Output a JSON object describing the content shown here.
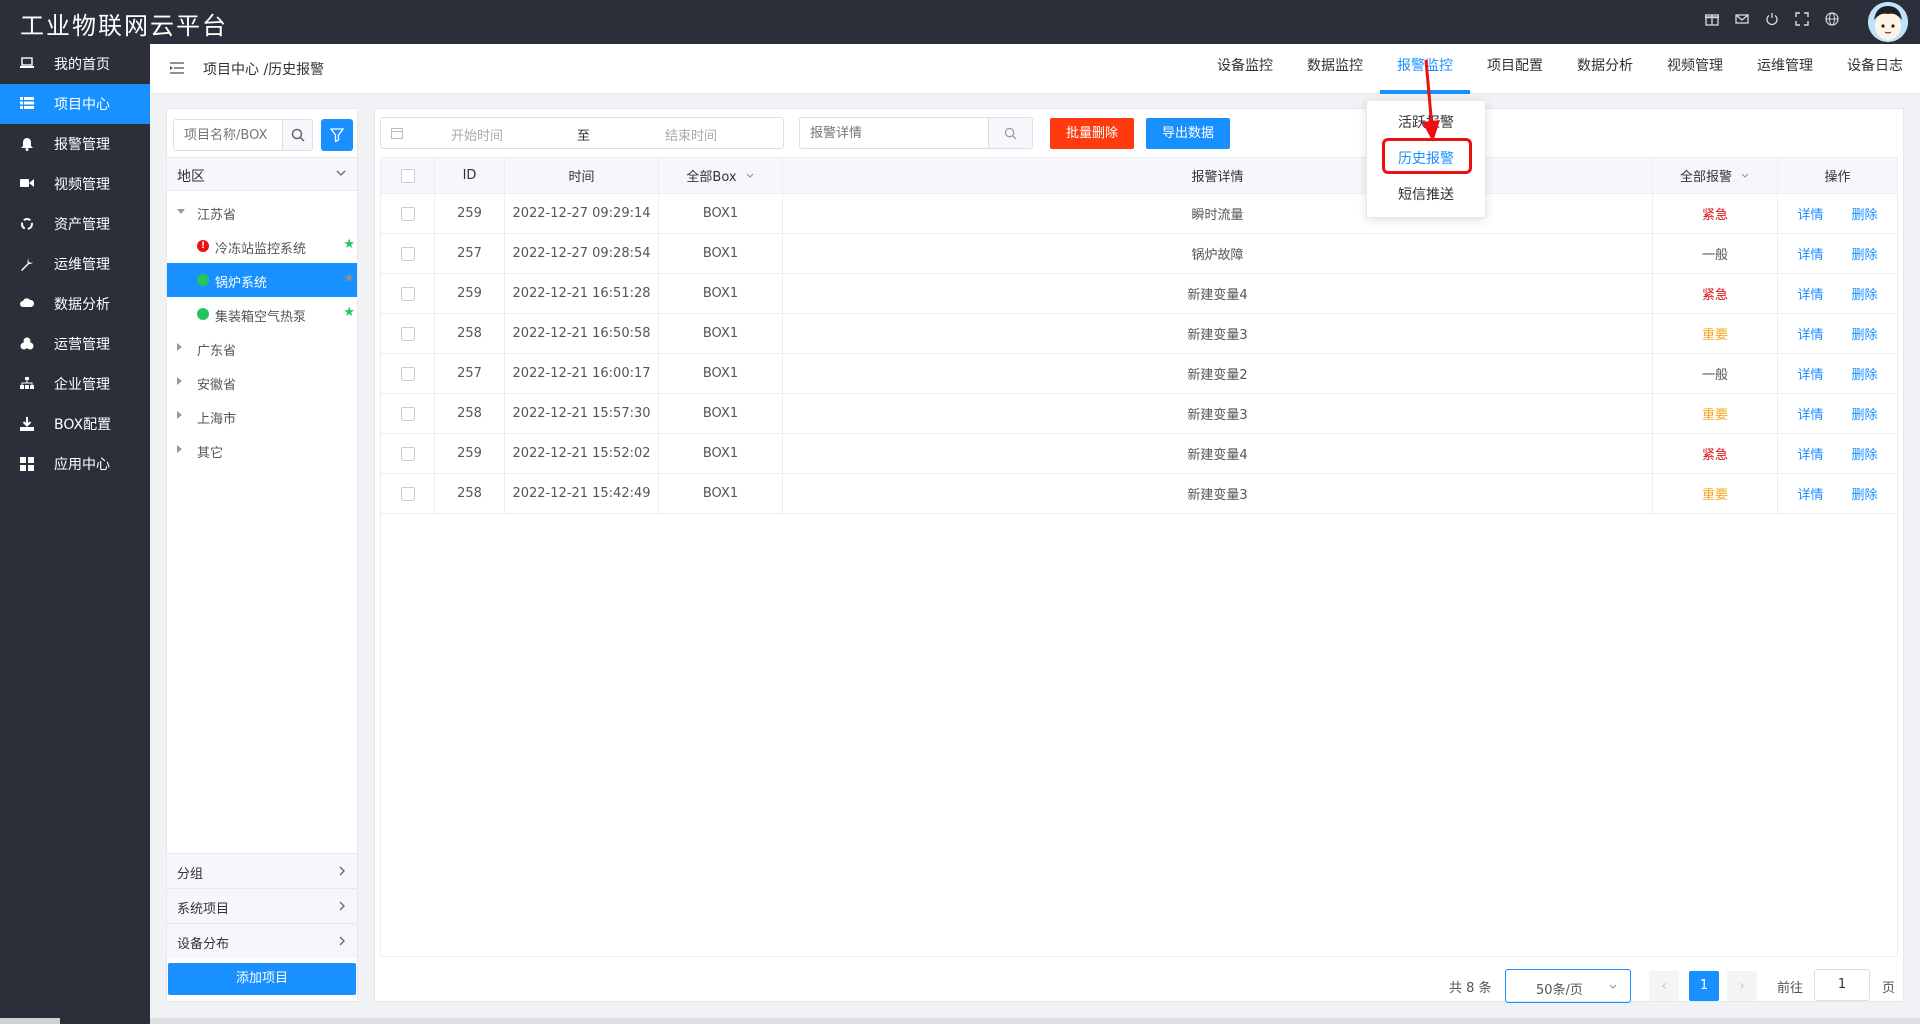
{
  "app": {
    "title": "工业物联网云平台"
  },
  "nav": {
    "items": [
      {
        "label": "我的首页",
        "icon": "laptop-icon"
      },
      {
        "label": "项目中心",
        "icon": "list-icon",
        "active": true
      },
      {
        "label": "报警管理",
        "icon": "bell-icon"
      },
      {
        "label": "视频管理",
        "icon": "video-icon"
      },
      {
        "label": "资产管理",
        "icon": "recycle-icon"
      },
      {
        "label": "运维管理",
        "icon": "wrench-icon"
      },
      {
        "label": "数据分析",
        "icon": "cloud-icon"
      },
      {
        "label": "运营管理",
        "icon": "cubes-icon"
      },
      {
        "label": "企业管理",
        "icon": "sitemap-icon"
      },
      {
        "label": "BOX配置",
        "icon": "download-icon"
      },
      {
        "label": "应用中心",
        "icon": "grid-icon"
      }
    ]
  },
  "header": {
    "breadcrumb": "项目中心 /历史报警",
    "tabs": [
      {
        "label": "设备监控"
      },
      {
        "label": "数据监控"
      },
      {
        "label": "报警监控",
        "active": true
      },
      {
        "label": "项目配置"
      },
      {
        "label": "数据分析"
      },
      {
        "label": "视频管理"
      },
      {
        "label": "运维管理"
      },
      {
        "label": "设备日志"
      }
    ]
  },
  "dropdown": {
    "items": [
      "活跃报警",
      "历史报警",
      "短信推送"
    ],
    "active_index": 1
  },
  "tree_panel": {
    "search_placeholder": "项目名称/BOX",
    "region_label": "地区",
    "nodes": [
      {
        "label": "江苏省",
        "expanded": true
      },
      {
        "label": "冷冻站监控系统",
        "status": "alarm"
      },
      {
        "label": "锅炉系统",
        "status": "online",
        "selected": true
      },
      {
        "label": "集装箱空气热泵",
        "status": "online"
      },
      {
        "label": "广东省"
      },
      {
        "label": "安徽省"
      },
      {
        "label": "上海市"
      },
      {
        "label": "其它"
      }
    ],
    "sections": [
      "分组",
      "系统项目",
      "设备分布"
    ],
    "add_button": "添加项目"
  },
  "toolbar": {
    "start_placeholder": "开始时间",
    "range_separator": "至",
    "end_placeholder": "结束时间",
    "detail_placeholder": "报警详情",
    "batch_delete": "批量删除",
    "export": "导出数据"
  },
  "table": {
    "headers": [
      "ID",
      "时间",
      "全部Box",
      "报警详情",
      "全部报警",
      "操作"
    ],
    "action_detail": "详情",
    "action_delete": "删除",
    "rows": [
      {
        "id": "259",
        "time": "2022-12-27 09:29:14",
        "box": "BOX1",
        "detail": "瞬时流量",
        "level": "紧急",
        "level_type": "urgent"
      },
      {
        "id": "257",
        "time": "2022-12-27 09:28:54",
        "box": "BOX1",
        "detail": "锅炉故障",
        "level": "一般",
        "level_type": "normal"
      },
      {
        "id": "259",
        "time": "2022-12-21 16:51:28",
        "box": "BOX1",
        "detail": "新建变量4",
        "level": "紧急",
        "level_type": "urgent"
      },
      {
        "id": "258",
        "time": "2022-12-21 16:50:58",
        "box": "BOX1",
        "detail": "新建变量3",
        "level": "重要",
        "level_type": "important"
      },
      {
        "id": "257",
        "time": "2022-12-21 16:00:17",
        "box": "BOX1",
        "detail": "新建变量2",
        "level": "一般",
        "level_type": "normal"
      },
      {
        "id": "258",
        "time": "2022-12-21 15:57:30",
        "box": "BOX1",
        "detail": "新建变量3",
        "level": "重要",
        "level_type": "important"
      },
      {
        "id": "259",
        "time": "2022-12-21 15:52:02",
        "box": "BOX1",
        "detail": "新建变量4",
        "level": "紧急",
        "level_type": "urgent"
      },
      {
        "id": "258",
        "time": "2022-12-21 15:42:49",
        "box": "BOX1",
        "detail": "新建变量3",
        "level": "重要",
        "level_type": "important"
      }
    ]
  },
  "pagination": {
    "total": "共 8 条",
    "page_size": "50条/页",
    "current": "1",
    "goto_label": "前往",
    "goto_value": "1",
    "goto_suffix": "页"
  },
  "colors": {
    "primary": "#1890ff",
    "danger": "#ff3a0f",
    "urgent": "#e0101a",
    "important": "#f5a623",
    "dark_bg": "#2b2f3a"
  }
}
